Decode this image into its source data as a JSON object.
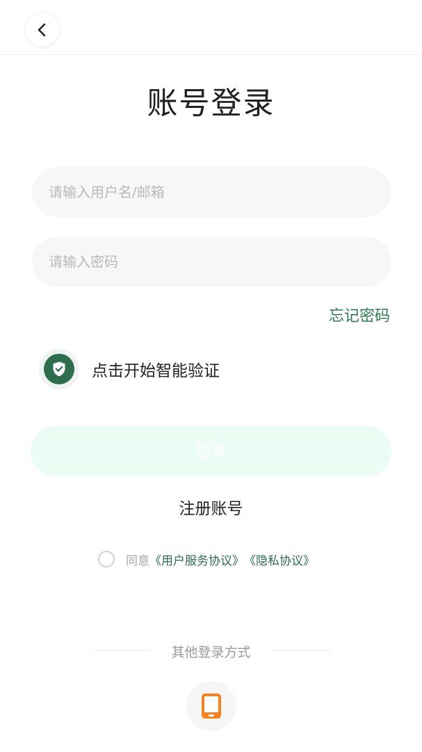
{
  "page": {
    "title": "账号登录"
  },
  "form": {
    "username_placeholder": "请输入用户名/邮箱",
    "username_value": "",
    "password_placeholder": "请输入密码",
    "password_value": "",
    "forgot_label": "忘记密码",
    "verify_label": "点击开始智能验证",
    "login_label": "登录",
    "register_label": "注册账号"
  },
  "agreement": {
    "prefix": "同意",
    "user_agreement": "《用户服务协议》",
    "privacy_policy": "《隐私协议》"
  },
  "other": {
    "label": "其他登录方式"
  },
  "icons": {
    "back": "chevron-left-icon",
    "verify": "shield-check-icon",
    "phone": "phone-icon"
  },
  "colors": {
    "accent": "#2e6e4f",
    "login_button_bg": "#eafcf4",
    "phone_icon": "#f5831f"
  }
}
